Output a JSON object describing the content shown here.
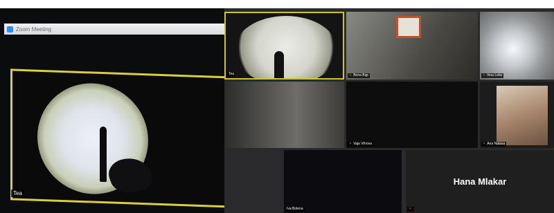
{
  "window": {
    "title": "Zoom Meeting"
  },
  "speaker": {
    "name": "Tea"
  },
  "gallery": {
    "tiles": [
      {
        "name": "Tea"
      },
      {
        "name": "Brina Bigi"
      },
      {
        "name": "Irina Lebo"
      },
      {
        "name": ""
      },
      {
        "name": "Vaja Vrhova"
      },
      {
        "name": "Ana Natasa"
      },
      {
        "name": "Iva Bolena"
      },
      {
        "name": "Hana Mlakar"
      }
    ]
  },
  "colors": {
    "active_speaker": "#d8cf3e",
    "zoom_blue": "#2d8cff",
    "muted_red": "#e04848"
  }
}
